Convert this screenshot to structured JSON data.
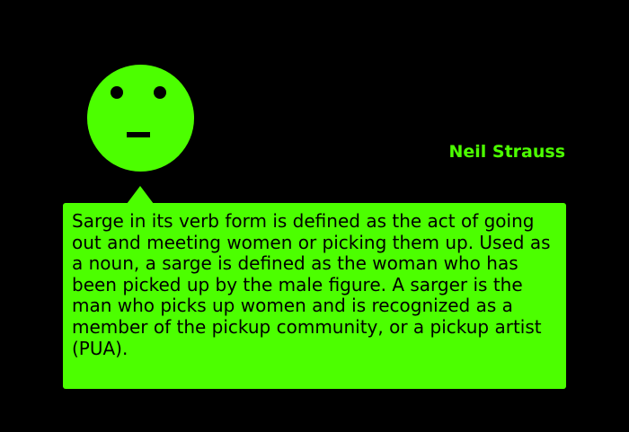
{
  "speaker": {
    "name": "Neil Strauss",
    "icon": "neutral-face-icon"
  },
  "quote": {
    "text": "Sarge in its verb form is defined as the act of going out and meeting women or picking them up. Used as a noun, a sarge is defined as the woman who has been picked up by the male figure. A sarger is the man who picks up women and is recognized as a member of the pickup community, or a pickup artist (PUA)."
  },
  "colors": {
    "background": "#000000",
    "accent": "#4cff00",
    "text_on_accent": "#000000"
  }
}
